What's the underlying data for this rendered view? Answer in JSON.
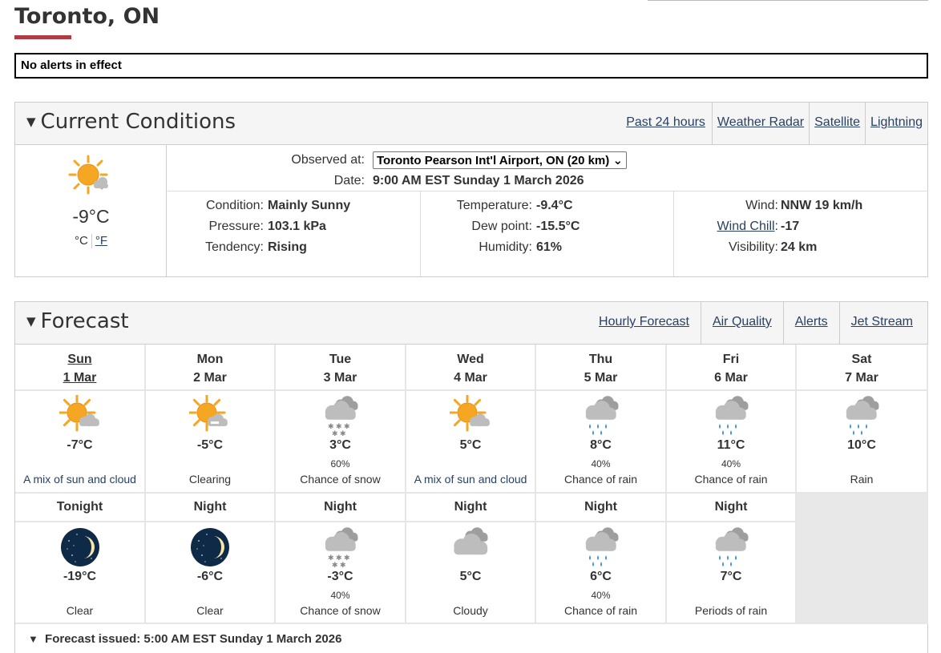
{
  "page": {
    "title": "Toronto, ON",
    "alert_text": "No alerts in effect"
  },
  "current": {
    "heading": "Current Conditions",
    "links": [
      "Past 24 hours",
      "Weather Radar",
      "Satellite",
      "Lightning"
    ],
    "icon": "sun-with-cloud-icon",
    "temp": "-9°C",
    "unit_c": "°C",
    "unit_f": "°F",
    "observed_label": "Observed at:",
    "observed_station": "Toronto Pearson Int'l Airport, ON (20 km)",
    "date_label": "Date:",
    "date_value": "9:00 AM EST Sunday 1 March 2026",
    "condition_label": "Condition:",
    "condition_value": "Mainly Sunny",
    "pressure_label": "Pressure:",
    "pressure_value": "103.1 kPa",
    "tendency_label": "Tendency:",
    "tendency_value": "Rising",
    "temperature_label": "Temperature:",
    "temperature_value": "-9.4°C",
    "dewpoint_label": "Dew point:",
    "dewpoint_value": "-15.5°C",
    "humidity_label": "Humidity:",
    "humidity_value": "61%",
    "wind_label": "Wind:",
    "wind_value": "NNW 19 km/h",
    "windchill_label": "Wind Chill",
    "windchill_value": "-17",
    "visibility_label": "Visibility:",
    "visibility_value": "24 km"
  },
  "forecast": {
    "heading": "Forecast",
    "links": [
      "Hourly Forecast",
      "Air Quality",
      "Alerts",
      "Jet Stream"
    ],
    "days": [
      {
        "day": "Sun",
        "date": "1 Mar",
        "icon": "sun-cloud",
        "temp": "-7°C",
        "pop": "",
        "summary": "A mix of sun and cloud"
      },
      {
        "day": "Mon",
        "date": "2 Mar",
        "icon": "sun-clearing",
        "temp": "-5°C",
        "pop": "",
        "summary": "Clearing"
      },
      {
        "day": "Tue",
        "date": "3 Mar",
        "icon": "cloud-snow",
        "temp": "3°C",
        "pop": "60%",
        "summary": "Chance of snow"
      },
      {
        "day": "Wed",
        "date": "4 Mar",
        "icon": "sun-cloud",
        "temp": "5°C",
        "pop": "",
        "summary": "A mix of sun and cloud"
      },
      {
        "day": "Thu",
        "date": "5 Mar",
        "icon": "cloud-rain",
        "temp": "8°C",
        "pop": "40%",
        "summary": "Chance of rain"
      },
      {
        "day": "Fri",
        "date": "6 Mar",
        "icon": "cloud-rain",
        "temp": "11°C",
        "pop": "40%",
        "summary": "Chance of rain"
      },
      {
        "day": "Sat",
        "date": "7 Mar",
        "icon": "cloud-rain",
        "temp": "10°C",
        "pop": "",
        "summary": "Rain"
      }
    ],
    "nights": [
      {
        "label": "Tonight",
        "icon": "moon",
        "temp": "-19°C",
        "pop": "",
        "summary": "Clear"
      },
      {
        "label": "Night",
        "icon": "moon",
        "temp": "-6°C",
        "pop": "",
        "summary": "Clear"
      },
      {
        "label": "Night",
        "icon": "cloud-snow",
        "temp": "-3°C",
        "pop": "40%",
        "summary": "Chance of snow"
      },
      {
        "label": "Night",
        "icon": "cloud",
        "temp": "5°C",
        "pop": "",
        "summary": "Cloudy"
      },
      {
        "label": "Night",
        "icon": "cloud-rain",
        "temp": "6°C",
        "pop": "40%",
        "summary": "Chance of rain"
      },
      {
        "label": "Night",
        "icon": "cloud-rain",
        "temp": "7°C",
        "pop": "",
        "summary": "Periods of rain"
      }
    ],
    "issued": "Forecast issued: 5:00 AM EST Sunday 1 March 2026"
  }
}
